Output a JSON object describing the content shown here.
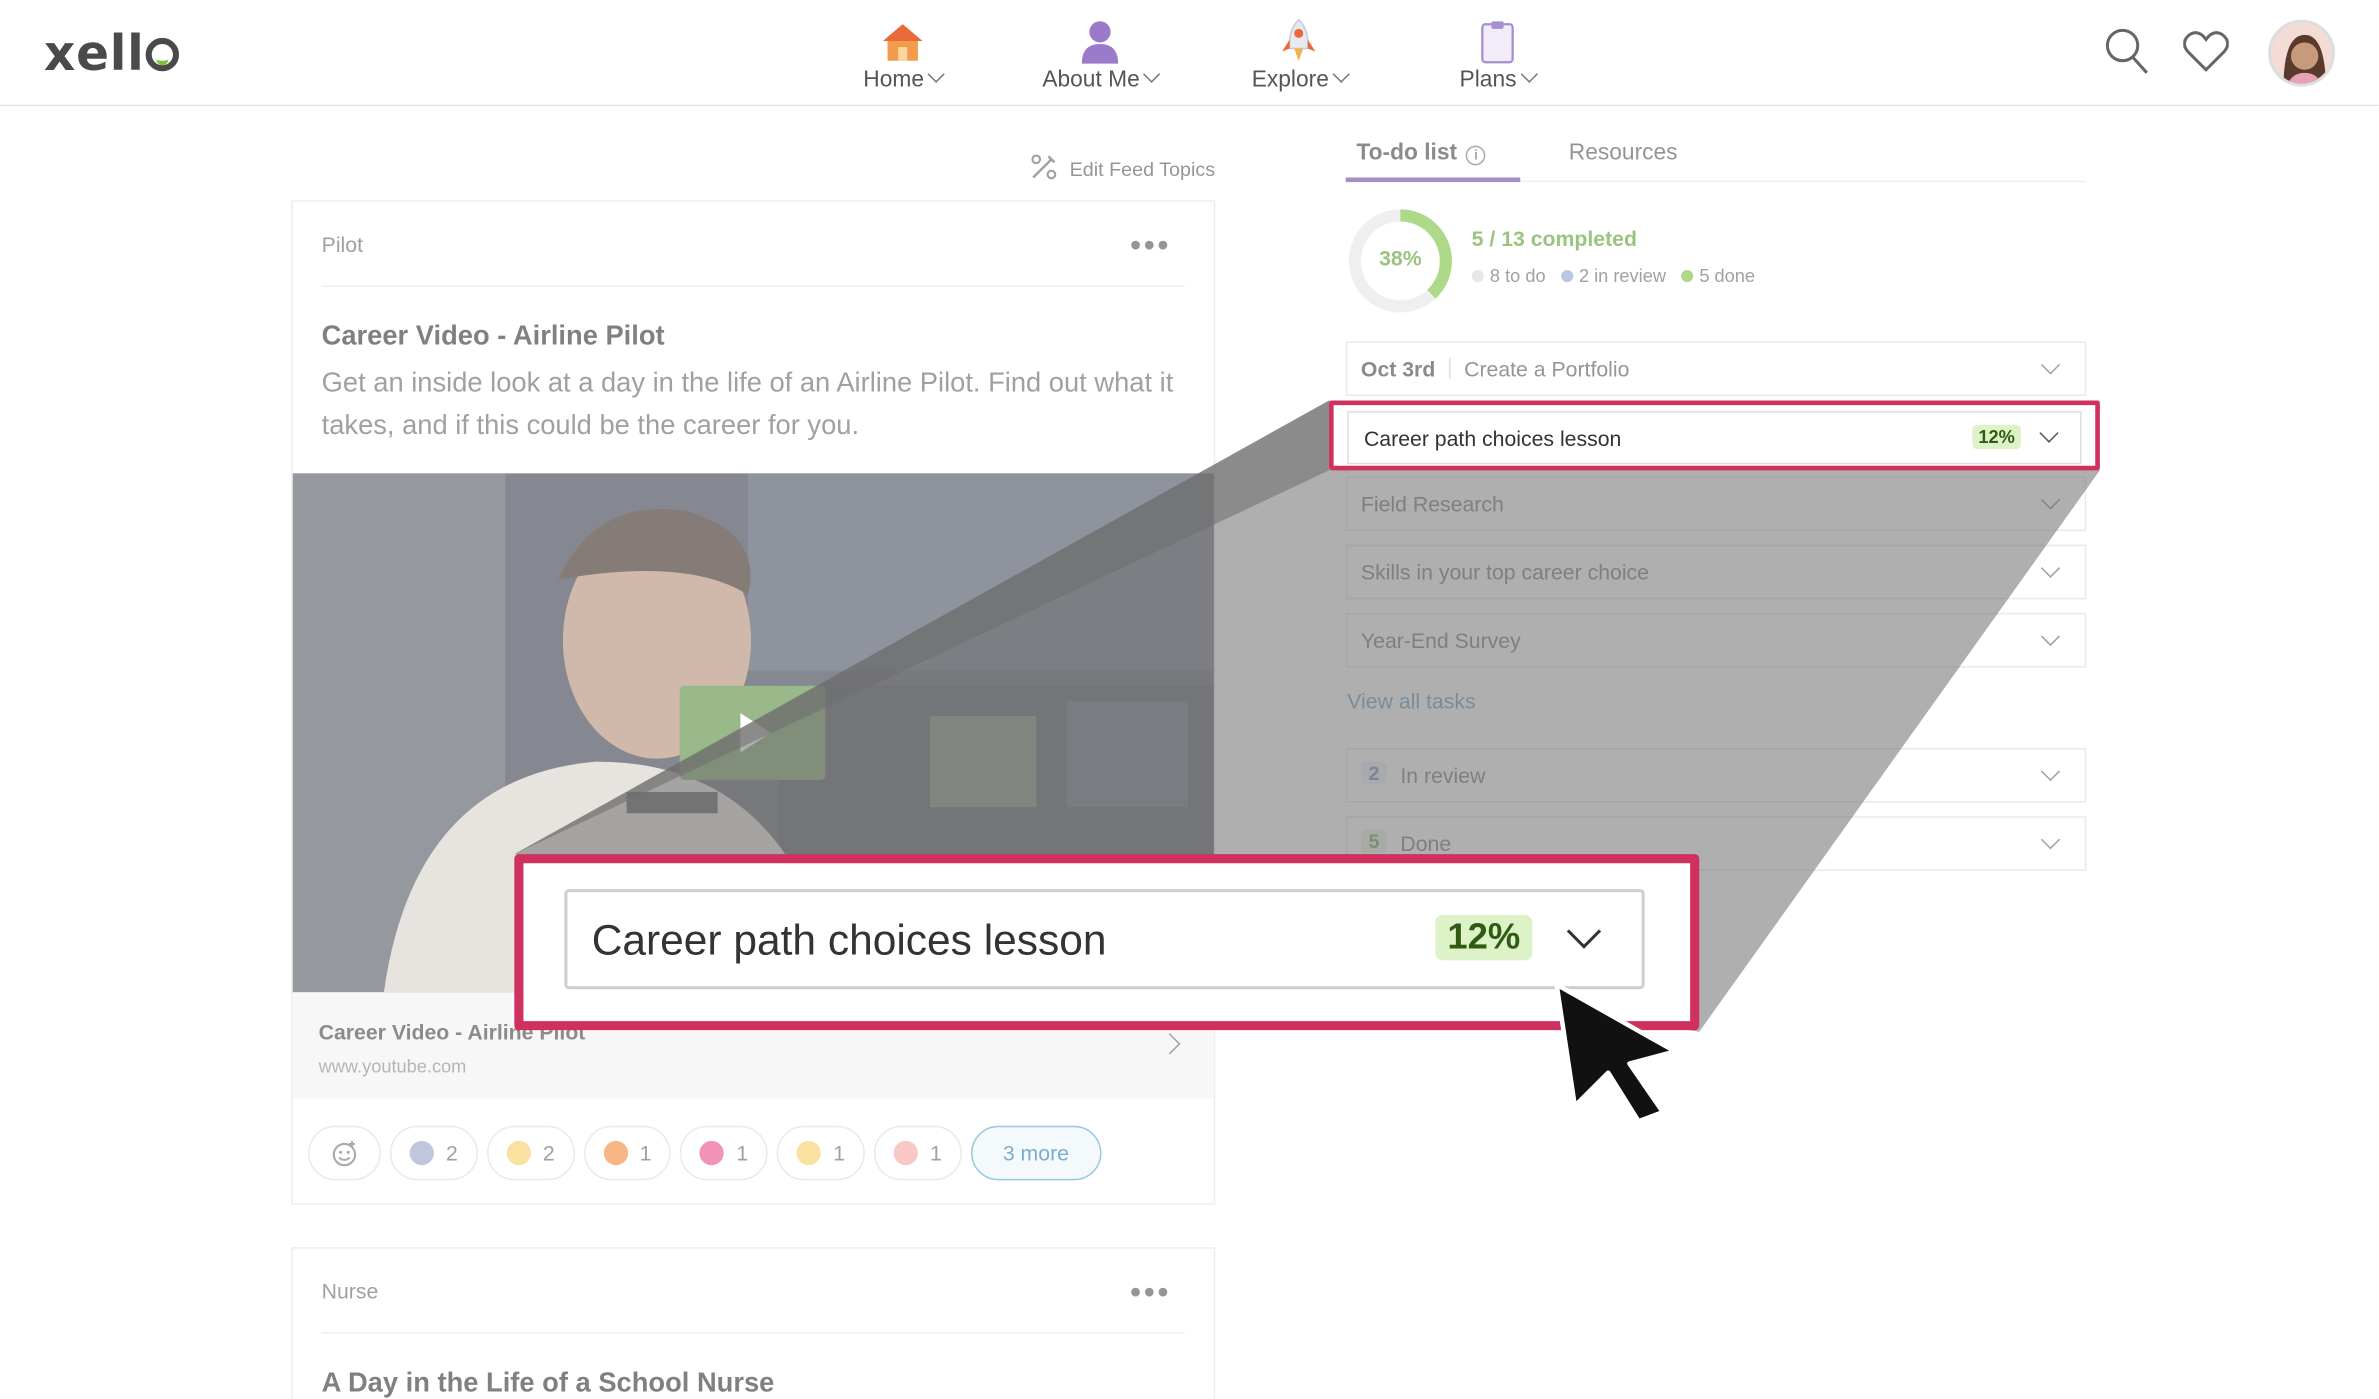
{
  "app": {
    "logo": "xello"
  },
  "nav": {
    "items": [
      {
        "label": "Home",
        "icon": "house-icon"
      },
      {
        "label": "About Me",
        "icon": "person-icon"
      },
      {
        "label": "Explore",
        "icon": "rocket-icon"
      },
      {
        "label": "Plans",
        "icon": "clipboard-icon"
      }
    ],
    "right_icons": [
      "search-icon",
      "heart-icon",
      "avatar"
    ]
  },
  "feed": {
    "edit_topics": "Edit Feed Topics",
    "cards": [
      {
        "category": "Pilot",
        "title": "Career Video - Airline Pilot",
        "description": "Get an inside look at a day in the life of an Airline Pilot. Find out what it takes, and if this could be the career for you.",
        "video_title": "Career Video - Airline Pilot",
        "video_source": "www.youtube.com",
        "reactions": [
          {
            "emoji": "eyes",
            "count": "2"
          },
          {
            "emoji": "clap",
            "count": "2"
          },
          {
            "emoji": "fire",
            "count": "1"
          },
          {
            "emoji": "heart-eyes",
            "count": "1"
          },
          {
            "emoji": "grimace",
            "count": "1"
          },
          {
            "emoji": "scream",
            "count": "1"
          }
        ],
        "more_label": "3 more"
      },
      {
        "category": "Nurse",
        "title": "A Day in the Life of a School Nurse"
      }
    ]
  },
  "todo": {
    "tabs": [
      "To-do list",
      "Resources"
    ],
    "progress_percent": "38%",
    "progress_fraction": 0.38,
    "completed_count": "5",
    "completed_total": "/ 13 completed",
    "legend": [
      {
        "label": "8 to do",
        "color": "#d9d9d9"
      },
      {
        "label": "2 in review",
        "color": "#8fa6d8"
      },
      {
        "label": "5 done",
        "color": "#7cc242"
      }
    ],
    "items": [
      {
        "date": "Oct 3rd",
        "label": "Create a Portfolio"
      },
      {
        "label": "Career path choices lesson",
        "badge": "12%"
      },
      {
        "label": "Field Research"
      },
      {
        "label": "Skills in your top career choice"
      },
      {
        "label": "Year-End Survey"
      }
    ],
    "view_all": "View all tasks",
    "status_rows": [
      {
        "count": "2",
        "label": "In review"
      },
      {
        "count": "5",
        "label": "Done"
      }
    ]
  },
  "zoom": {
    "label": "Career path choices lesson",
    "badge": "12%"
  },
  "colors": {
    "highlight": "#d0305e",
    "accent": "#6a4ea3",
    "green": "#7cc242",
    "link": "#3d83b8"
  }
}
